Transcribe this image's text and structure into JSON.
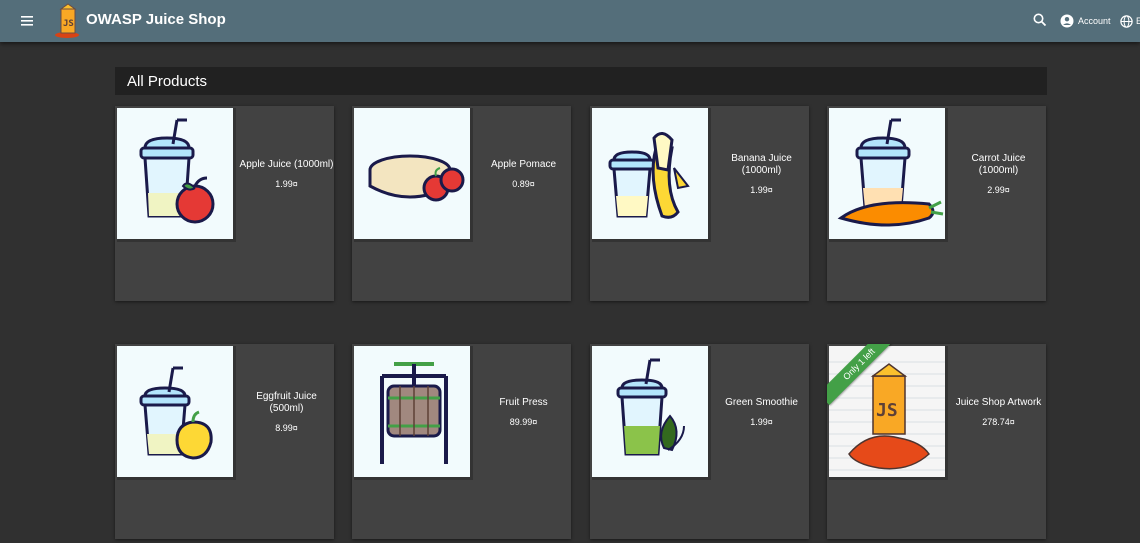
{
  "app": {
    "title": "OWASP Juice Shop"
  },
  "toolbar": {
    "account_label": "Account",
    "language_label": "E"
  },
  "main": {
    "heading": "All Products"
  },
  "products": [
    {
      "name": "Apple Juice (1000ml)",
      "price": "1.99¤"
    },
    {
      "name": "Apple Pomace",
      "price": "0.89¤"
    },
    {
      "name": "Banana Juice (1000ml)",
      "price": "1.99¤"
    },
    {
      "name": "Carrot Juice (1000ml)",
      "price": "2.99¤"
    },
    {
      "name": "Eggfruit Juice (500ml)",
      "price": "8.99¤"
    },
    {
      "name": "Fruit Press",
      "price": "89.99¤"
    },
    {
      "name": "Green Smoothie",
      "price": "1.99¤"
    },
    {
      "name": "Juice Shop Artwork",
      "price": "278.74¤",
      "ribbon": "Only 1 left"
    }
  ],
  "colors": {
    "toolbar": "#546e7a",
    "background": "#303030",
    "card": "#424242",
    "ribbon": "#43a047"
  }
}
